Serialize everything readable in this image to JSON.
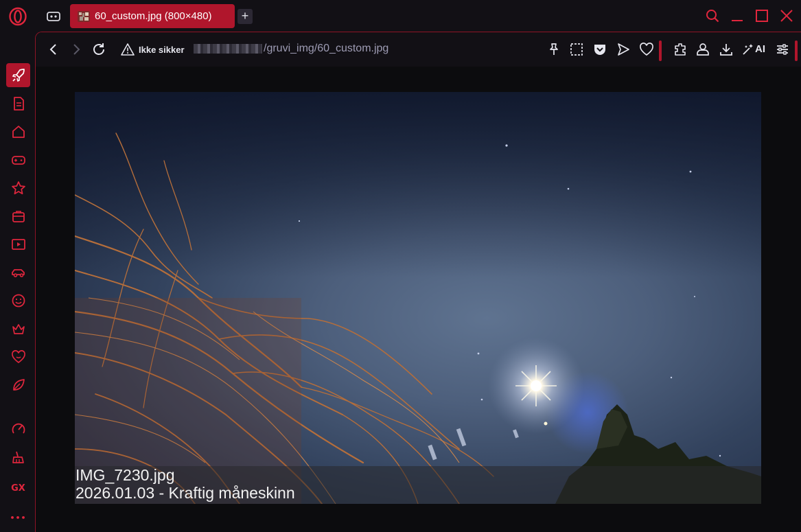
{
  "titlebar": {
    "tab_title": "60_custom.jpg (800×480)",
    "new_tab_label": "+"
  },
  "addressbar": {
    "security_label": "Ikke sikker",
    "url_path": "/gruvi_img/60_custom.jpg",
    "ai_label": "AI"
  },
  "image": {
    "caption_filename": "IMG_7230.jpg",
    "caption_description": "2026.01.03 - Kraftig måneskinn"
  },
  "sidebar": {
    "gx_label": "GX",
    "more_label": "•••"
  },
  "colors": {
    "accent": "#b0162c",
    "accent_bright": "#e0263d",
    "background": "#121015"
  }
}
